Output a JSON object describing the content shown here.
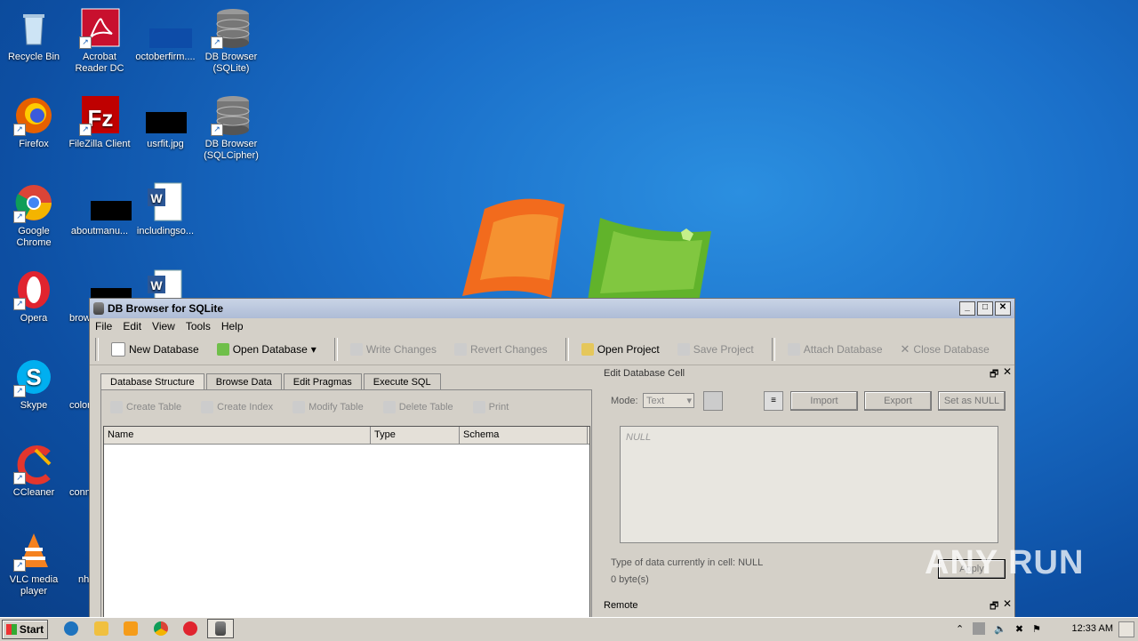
{
  "desktop": {
    "icons": [
      {
        "label": "Recycle Bin"
      },
      {
        "label": "Acrobat Reader DC"
      },
      {
        "label": "octoberfirm...."
      },
      {
        "label": "DB Browser (SQLite)"
      },
      {
        "label": "Firefox"
      },
      {
        "label": "FileZilla Client"
      },
      {
        "label": "usrfit.jpg"
      },
      {
        "label": "DB Browser (SQLCipher)"
      },
      {
        "label": "Google Chrome"
      },
      {
        "label": "aboutmanu..."
      },
      {
        "label": "includingso..."
      },
      {
        "label": "Opera"
      },
      {
        "label": "brow"
      },
      {
        "label": "Skype"
      },
      {
        "label": "color"
      },
      {
        "label": "CCleaner"
      },
      {
        "label": "conn"
      },
      {
        "label": "VLC media player"
      },
      {
        "label": "nh"
      }
    ]
  },
  "window": {
    "title": "DB Browser for SQLite",
    "menu": [
      "File",
      "Edit",
      "View",
      "Tools",
      "Help"
    ],
    "toolbar": {
      "new_db": "New Database",
      "open_db": "Open Database",
      "write": "Write Changes",
      "revert": "Revert Changes",
      "open_project": "Open Project",
      "save_project": "Save Project",
      "attach": "Attach Database",
      "close": "Close Database"
    },
    "tabs": [
      "Database Structure",
      "Browse Data",
      "Edit Pragmas",
      "Execute SQL"
    ],
    "subtoolbar": {
      "create_table": "Create Table",
      "create_index": "Create Index",
      "modify_table": "Modify Table",
      "delete_table": "Delete Table",
      "print": "Print"
    },
    "grid_headers": [
      "Name",
      "Type",
      "Schema"
    ],
    "edit_cell": {
      "title": "Edit Database Cell",
      "mode_label": "Mode:",
      "mode_value": "Text",
      "import": "Import",
      "export": "Export",
      "set_null": "Set as NULL",
      "placeholder": "NULL",
      "type_info": "Type of data currently in cell: NULL",
      "size_info": "0 byte(s)",
      "apply": "Apply"
    },
    "remote_label": "Remote"
  },
  "taskbar": {
    "start": "Start",
    "clock": "12:33 AM"
  },
  "watermark": "ANY RUN"
}
